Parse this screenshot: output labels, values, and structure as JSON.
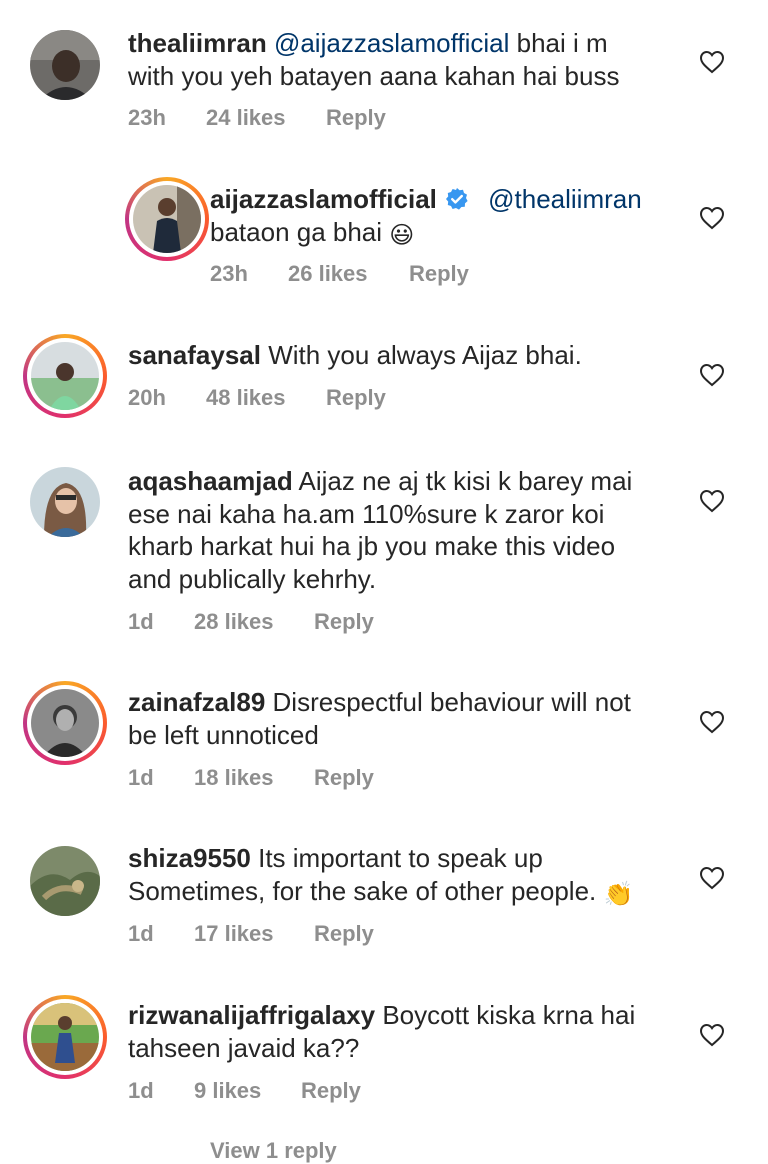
{
  "comments": [
    {
      "username": "thealiimran",
      "mention": "@aijazzaslamofficial",
      "text_line1": " bhai i m",
      "text_line2": "with you yeh batayen aana kahan hai buss",
      "time": "23h",
      "likes": "24 likes",
      "reply": "Reply"
    },
    {
      "username": "aijazzaslamofficial",
      "mention": "@thealiimran",
      "text_line2": "bataon ga bhai",
      "emoji": "😃",
      "time": "23h",
      "likes": "26 likes",
      "reply": "Reply"
    },
    {
      "username": "sanafaysal",
      "text_line1": " With you always Aijaz bhai.",
      "time": "20h",
      "likes": "48 likes",
      "reply": "Reply"
    },
    {
      "username": "aqashaamjad",
      "text_line1": " Aijaz ne aj tk kisi k barey mai",
      "text_line2": "ese nai kaha ha.am 110%sure k zaror koi",
      "text_line3": "kharb harkat hui ha jb you make this video",
      "text_line4": "and publically kehrhy.",
      "time": "1d",
      "likes": "28 likes",
      "reply": "Reply"
    },
    {
      "username": "zainafzal89",
      "text_line1": " Disrespectful behaviour will not",
      "text_line2": "be left unnoticed",
      "time": "1d",
      "likes": "18 likes",
      "reply": "Reply"
    },
    {
      "username": "shiza9550",
      "text_line1": " Its important to speak up",
      "text_line2": "Sometimes, for the sake of other people.",
      "emoji": "👏",
      "time": "1d",
      "likes": "17 likes",
      "reply": "Reply"
    },
    {
      "username": "rizwanalijaffrigalaxy",
      "text_line1": " Boycott kiska krna hai",
      "text_line2": "tahseen javaid ka??",
      "time": "1d",
      "likes": "9 likes",
      "reply": "Reply"
    }
  ],
  "view_more": "View 1 reply",
  "colors": {
    "text": "#262626",
    "meta": "#8e8e8e",
    "mention": "#003569",
    "verified": "#3897f0"
  }
}
